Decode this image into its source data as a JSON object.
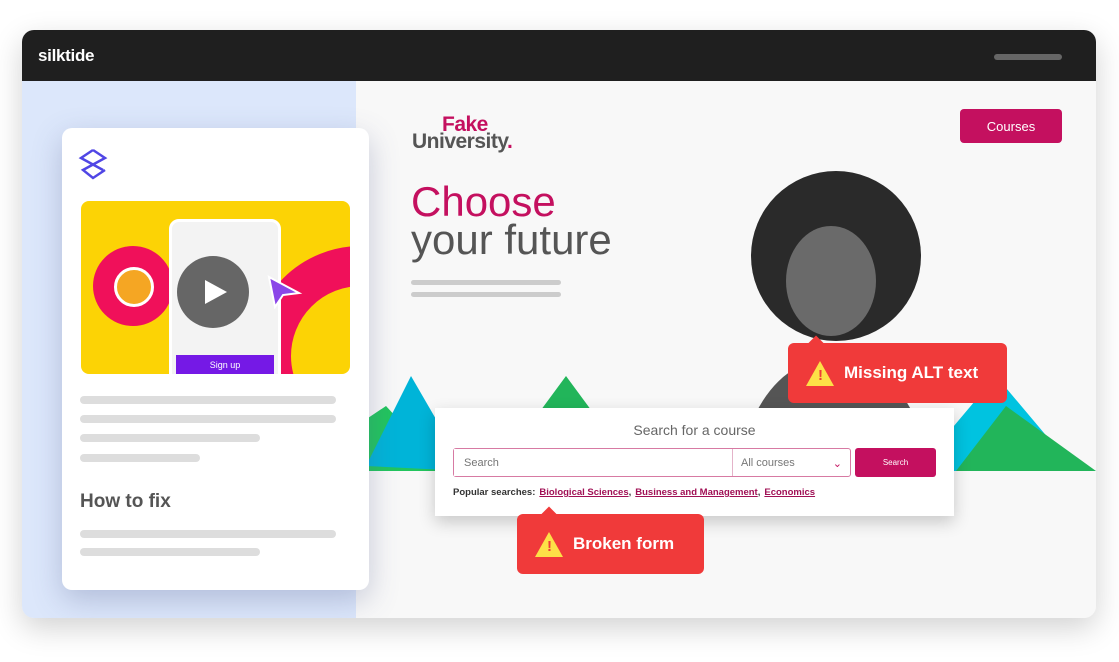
{
  "app": {
    "brand": "silktide"
  },
  "card": {
    "signup_label": "Sign up",
    "how_to_fix": "How to fix"
  },
  "site": {
    "logo_top": "Fake",
    "logo_bottom": "University",
    "logo_dot": ".",
    "courses_button": "Courses",
    "headline_1": "Choose",
    "headline_2": "your future",
    "search": {
      "title": "Search for a course",
      "placeholder": "Search",
      "select_value": "All courses",
      "button": "Search",
      "popular_label": "Popular searches:",
      "links": [
        "Biological Sciences",
        "Business and Management",
        "Economics"
      ]
    }
  },
  "issues": {
    "missing_alt": "Missing ALT text",
    "broken_form": "Broken form"
  },
  "colors": {
    "accent": "#c4105f",
    "warning": "#f03a3a",
    "silktide_purple": "#5046e5"
  }
}
